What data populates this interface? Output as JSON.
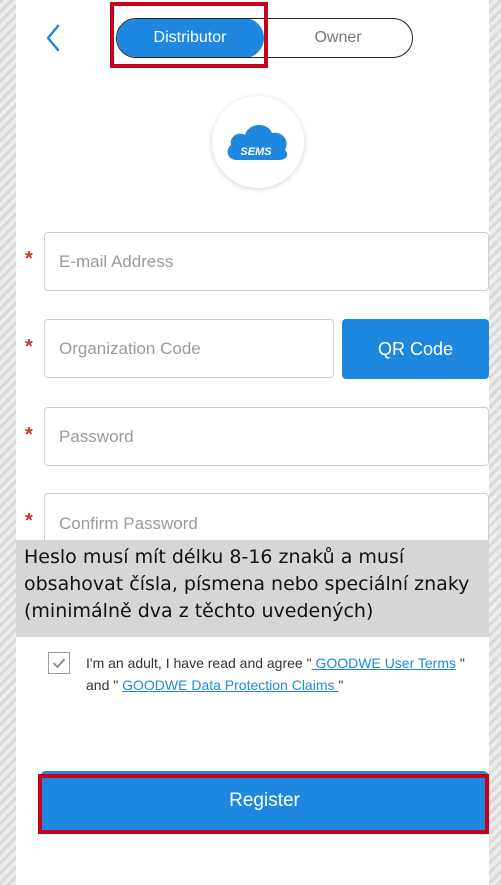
{
  "header": {
    "tabs": [
      "Distributor",
      "Owner"
    ],
    "active_tab": "Distributor"
  },
  "logo": {
    "text": "SEMS"
  },
  "form": {
    "email_placeholder": "E-mail Address",
    "org_code_placeholder": "Organization Code",
    "qr_button": "QR Code",
    "password_placeholder": "Password",
    "confirm_password_placeholder": "Confirm Password",
    "required_mark": "*"
  },
  "tooltip": {
    "line1": "Heslo musí mít délku 8-16 znaků a musí",
    "line2": "obsahovat čísla, písmena nebo speciální znaky",
    "line3": "(minimálně dva z těchto uvedených)"
  },
  "terms": {
    "checked": true,
    "prefix": "I'm an adult, I have read and agree \"",
    "link1": " GOODWE User Terms",
    "middle": " \" and \" ",
    "link2": "GOODWE Data Protection Claims ",
    "suffix": "\""
  },
  "register": {
    "label": "Register"
  },
  "colors": {
    "accent": "#1e88e0",
    "required": "#d93030",
    "highlight": "#c8001e"
  }
}
